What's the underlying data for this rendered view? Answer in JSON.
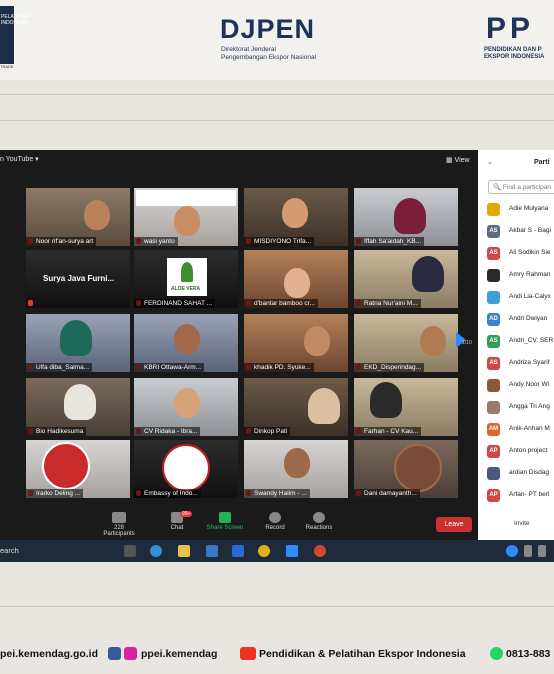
{
  "header": {
    "left_logo_text": "PELATIHAN\nINDONESIA",
    "left_logo_sub": "TRADE",
    "djpen_title": "DJPEN",
    "djpen_line1": "Direktorat Jenderal",
    "djpen_line2": "Pengembangan Ekspor Nasional",
    "ppei_title": "PP",
    "ppei_line1": "PENDIDIKAN DAN P",
    "ppei_line2": "EKSPOR INDONESIA"
  },
  "zoom": {
    "stream_label": "n YouTube ▾",
    "view_label": "▦ View",
    "page_indicator": "1/10",
    "tiles": [
      {
        "name": "Noor rif'an-surya art"
      },
      {
        "name": "wasi yanto"
      },
      {
        "name": "MISDIYONO Trifa..."
      },
      {
        "name": "Iffah Sa'aidah_KB..."
      },
      {
        "name": "Surya Java Furni...",
        "big_text": "Surya Java Furni..."
      },
      {
        "name": "FERDINAND SAHAT ...",
        "logo_text": "ALOE VERA"
      },
      {
        "name": "d'bantar bamboo cr..."
      },
      {
        "name": "Ratna Nur'aini M..."
      },
      {
        "name": "Ulfa diba_Salma..."
      },
      {
        "name": "KBRI Ottawa-Arm..."
      },
      {
        "name": "khadik PD. Syuke..."
      },
      {
        "name": "EKD_Disperindag..."
      },
      {
        "name": "Bio Hadikesuma"
      },
      {
        "name": "CV Ridaka - Ibra..."
      },
      {
        "name": "Dinkop Pati"
      },
      {
        "name": "Farhan - CV Kau..."
      },
      {
        "name": "Irarko Deling ..."
      },
      {
        "name": "Embassy of Indo..."
      },
      {
        "name": "Swandy Halim - ..."
      },
      {
        "name": "Dani damayanth..."
      }
    ],
    "controls": {
      "participants_count": "228",
      "participants_label": "Participants",
      "chat_label": "Chat",
      "chat_badge": "99+",
      "share_label": "Share Screen",
      "record_label": "Record",
      "reactions_label": "Reactions",
      "leave_label": "Leave"
    },
    "panel": {
      "title": "Parti",
      "find_placeholder": "Find a participan",
      "invite_label": "Invite",
      "participants": [
        {
          "initials": "",
          "name": "Adie Mulyana",
          "color": "#e0a800"
        },
        {
          "initials": "AS",
          "name": "Akbar S - Bagi",
          "color": "#5b6d85"
        },
        {
          "initials": "AS",
          "name": "Ali Sodikin Sie",
          "color": "#d64545"
        },
        {
          "initials": "",
          "name": "Amry Rahman",
          "color": "#2a2a2a"
        },
        {
          "initials": "",
          "name": "Andi Lia-Calyx",
          "color": "#3aa0d8"
        },
        {
          "initials": "AD",
          "name": "Andri Dwiyan",
          "color": "#3b82d6"
        },
        {
          "initials": "AS",
          "name": "Andri_CV. SER",
          "color": "#2f9e5b"
        },
        {
          "initials": "AS",
          "name": "Andriza Syarif",
          "color": "#d64545"
        },
        {
          "initials": "",
          "name": "Andy Noor Wi",
          "color": "#8a5a3a"
        },
        {
          "initials": "",
          "name": "Angga Tri Ang",
          "color": "#9a7a6a"
        },
        {
          "initials": "AM",
          "name": "Anik-Anhan M",
          "color": "#e0662a"
        },
        {
          "initials": "AP",
          "name": "Anton project",
          "color": "#d64545"
        },
        {
          "initials": "",
          "name": "ardian Disdag",
          "color": "#4a5a7a"
        },
        {
          "initials": "AP",
          "name": "Arfan- PT berl",
          "color": "#d64545"
        }
      ]
    }
  },
  "taskbar": {
    "search_label": "earch"
  },
  "footer": {
    "website": "pei.kemendag.go.id",
    "social_handle": "ppei.kemendag",
    "youtube_channel": "Pendidikan & Pelatihan Ekspor Indonesia",
    "whatsapp": "0813-883"
  }
}
